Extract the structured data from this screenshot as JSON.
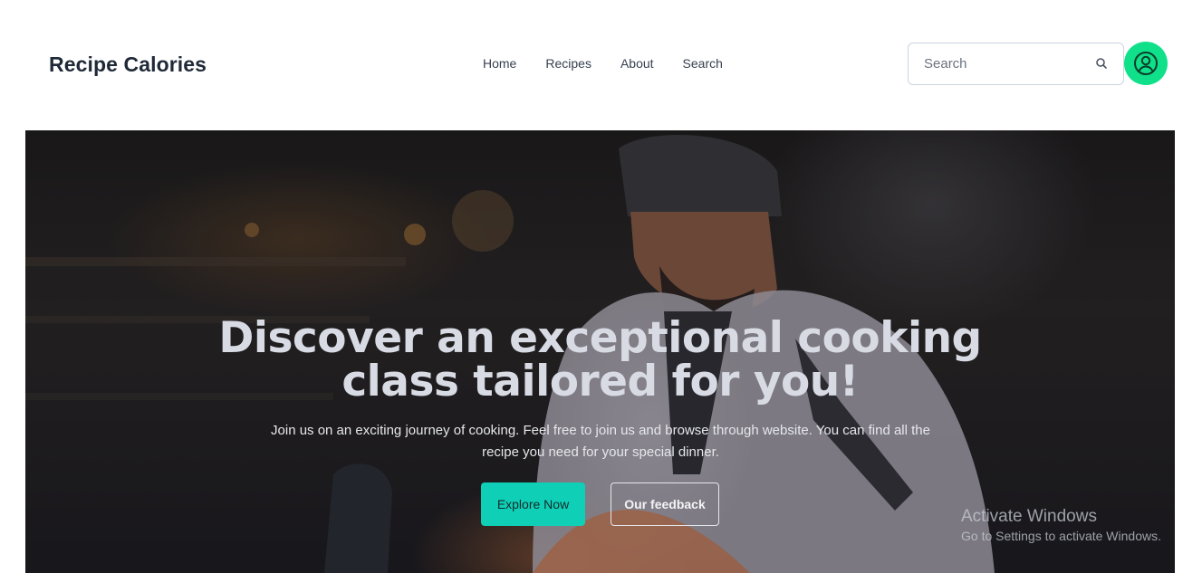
{
  "navbar": {
    "brand": "Recipe Calories",
    "links": [
      "Home",
      "Recipes",
      "About",
      "Search"
    ],
    "search": {
      "placeholder": "Search",
      "value": ""
    },
    "icons": {
      "search": "search-icon",
      "account": "user-circle-icon"
    },
    "accent_color": "#10e08a"
  },
  "hero": {
    "title_line1": "Discover an exceptional cooking",
    "title_line2": "class tailored for you!",
    "subtitle": "Join us on an exciting journey of cooking. Feel free to join us and browse through website. You can find all the recipe you need for your special dinner.",
    "primary_button": "Explore Now",
    "secondary_button": "Our feedback",
    "primary_color": "#0fd0b7"
  },
  "os_watermark": {
    "title": "Activate Windows",
    "subtitle": "Go to Settings to activate Windows."
  }
}
